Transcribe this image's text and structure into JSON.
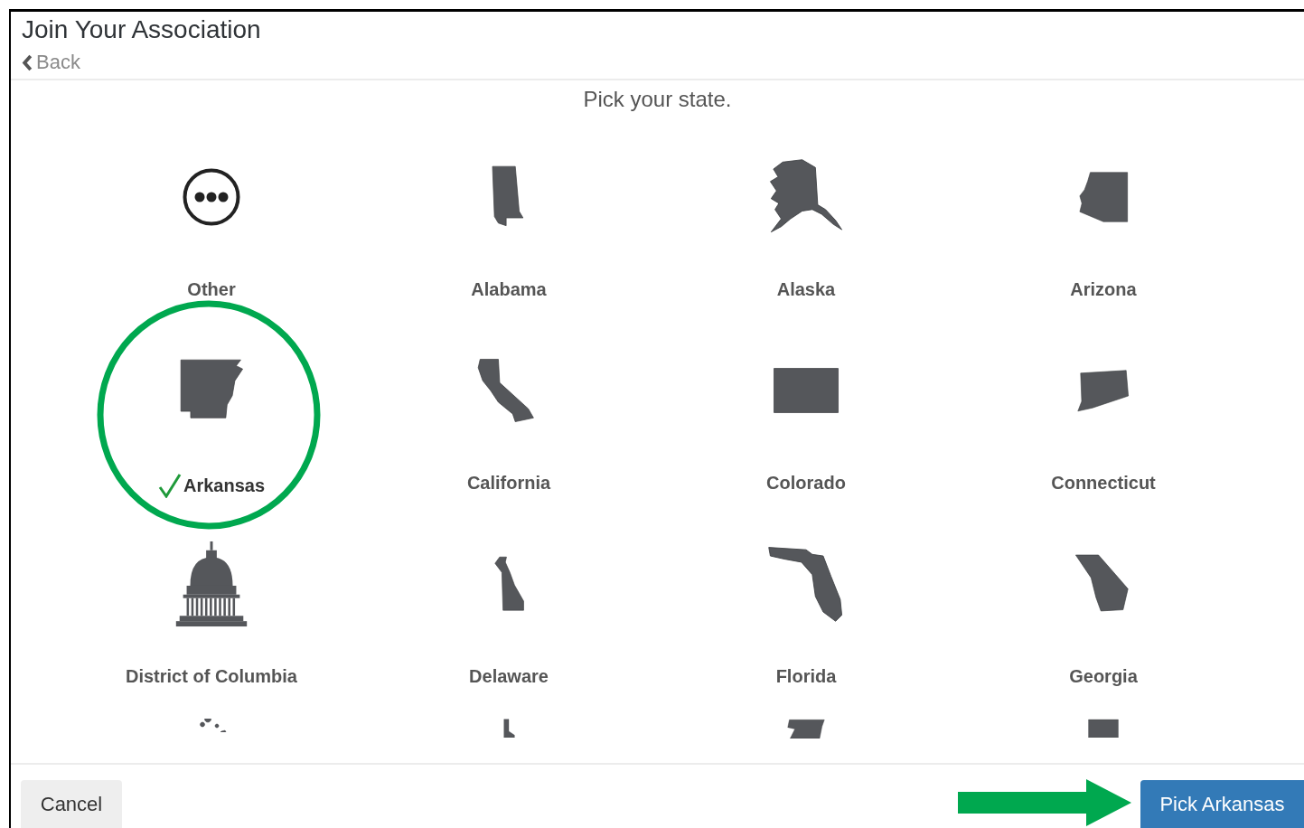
{
  "header": {
    "title": "Join Your Association",
    "back_link": "Back"
  },
  "prompt": "Pick your state.",
  "items": [
    {
      "kind": "ellipsis",
      "name": "Other",
      "selected": false
    },
    {
      "kind": "state",
      "name": "Alabama",
      "selected": false
    },
    {
      "kind": "state",
      "name": "Alaska",
      "selected": false
    },
    {
      "kind": "state",
      "name": "Arizona",
      "selected": false
    },
    {
      "kind": "state",
      "name": "Arkansas",
      "selected": true
    },
    {
      "kind": "state",
      "name": "California",
      "selected": false
    },
    {
      "kind": "state",
      "name": "Colorado",
      "selected": false
    },
    {
      "kind": "state",
      "name": "Connecticut",
      "selected": false
    },
    {
      "kind": "capitol",
      "name": "District of Columbia",
      "selected": false
    },
    {
      "kind": "state",
      "name": "Delaware",
      "selected": false
    },
    {
      "kind": "state",
      "name": "Florida",
      "selected": false
    },
    {
      "kind": "state",
      "name": "Georgia",
      "selected": false
    },
    {
      "kind": "cut"
    },
    {
      "kind": "cut"
    },
    {
      "kind": "cut"
    },
    {
      "kind": "cut"
    }
  ],
  "footer": {
    "cancel_button": "Cancel",
    "confirm_button": "Pick Arkansas"
  }
}
